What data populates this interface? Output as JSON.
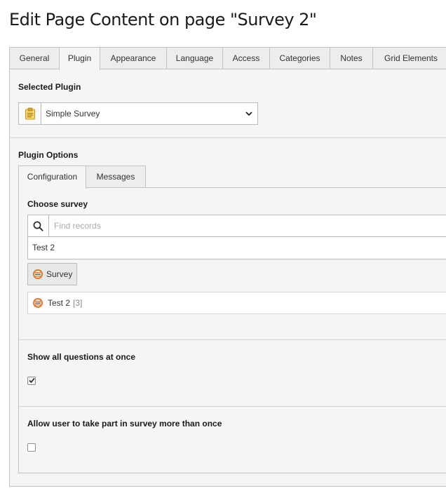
{
  "page": {
    "title": "Edit Page Content on page \"Survey 2\""
  },
  "main_tabs": [
    {
      "label": "General"
    },
    {
      "label": "Plugin"
    },
    {
      "label": "Appearance"
    },
    {
      "label": "Language"
    },
    {
      "label": "Access"
    },
    {
      "label": "Categories"
    },
    {
      "label": "Notes"
    },
    {
      "label": "Grid Elements"
    }
  ],
  "active_main_tab": "Plugin",
  "plugin": {
    "selected_label": "Selected Plugin",
    "selected_value": "Simple Survey",
    "icon": "clipboard-plugin-icon",
    "options_label": "Plugin Options"
  },
  "sub_tabs": [
    {
      "label": "Configuration"
    },
    {
      "label": "Messages"
    }
  ],
  "active_sub_tab": "Configuration",
  "config": {
    "choose_survey_label": "Choose survey",
    "search_placeholder": "Find records",
    "selected_item": "Test 2",
    "record_type_button": "Survey",
    "record_row": {
      "title": "Test 2",
      "uid": "[3]"
    },
    "show_all_label": "Show all questions at once",
    "show_all_checked": true,
    "allow_multiple_label": "Allow user to take part in survey more than once",
    "allow_multiple_checked": false
  },
  "colors": {
    "accent_icon": "#e8762d",
    "panel_bg": "#f5f5f5",
    "tab_bg": "#ededed",
    "border": "#c3c3c3"
  }
}
